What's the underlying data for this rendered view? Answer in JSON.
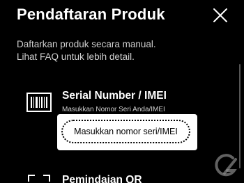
{
  "header": {
    "title": "Pendaftaran Produk",
    "close_icon": "close-icon"
  },
  "description": {
    "line1": "Daftarkan produk secara manual.",
    "line2": "Lihat FAQ untuk lebih detail."
  },
  "serial_option": {
    "icon": "barcode-icon",
    "title": "Serial Number / IMEI",
    "subtitle": "Masukkan Nomor Seri Anda/IMEI",
    "input_value": "Masukkan nomor seri/IMEI"
  },
  "qr_option": {
    "icon": "qr-scan-icon",
    "title": "Pemindaian QR"
  },
  "colors": {
    "background": "#000000",
    "text": "#ffffff",
    "secondary_text": "#cfcfcf",
    "highlight": "#ffffff"
  }
}
